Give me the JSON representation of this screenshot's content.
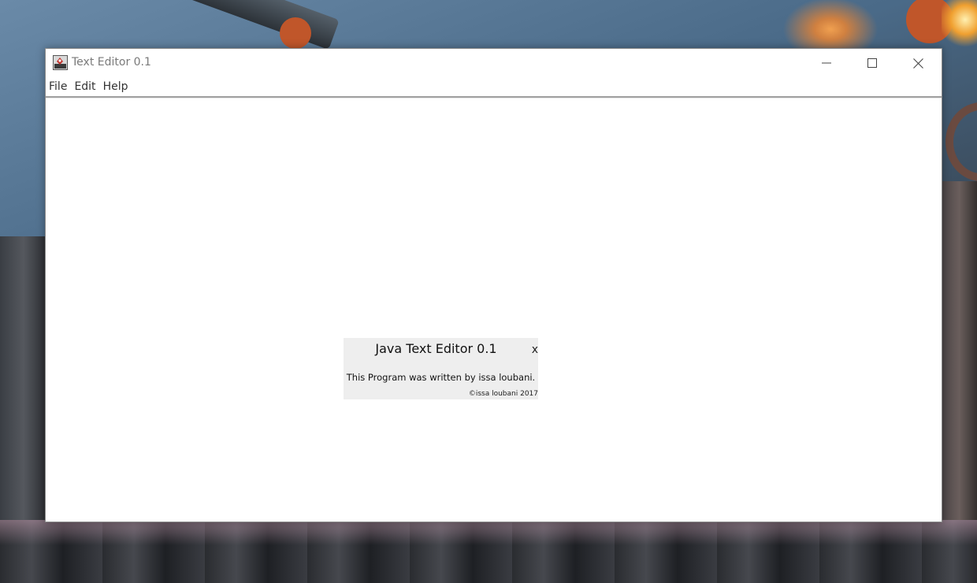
{
  "window": {
    "title": "Text Editor 0.1"
  },
  "menubar": {
    "items": [
      "File",
      "Edit",
      "Help"
    ]
  },
  "about_dialog": {
    "title": "Java Text Editor 0.1",
    "close_label": "x",
    "body": "This Program was written by issa loubani.",
    "copyright": "©issa loubani 2017"
  },
  "icons": {
    "app": "java-app-icon",
    "minimize": "minimize-icon",
    "maximize": "maximize-icon",
    "close": "close-icon"
  }
}
